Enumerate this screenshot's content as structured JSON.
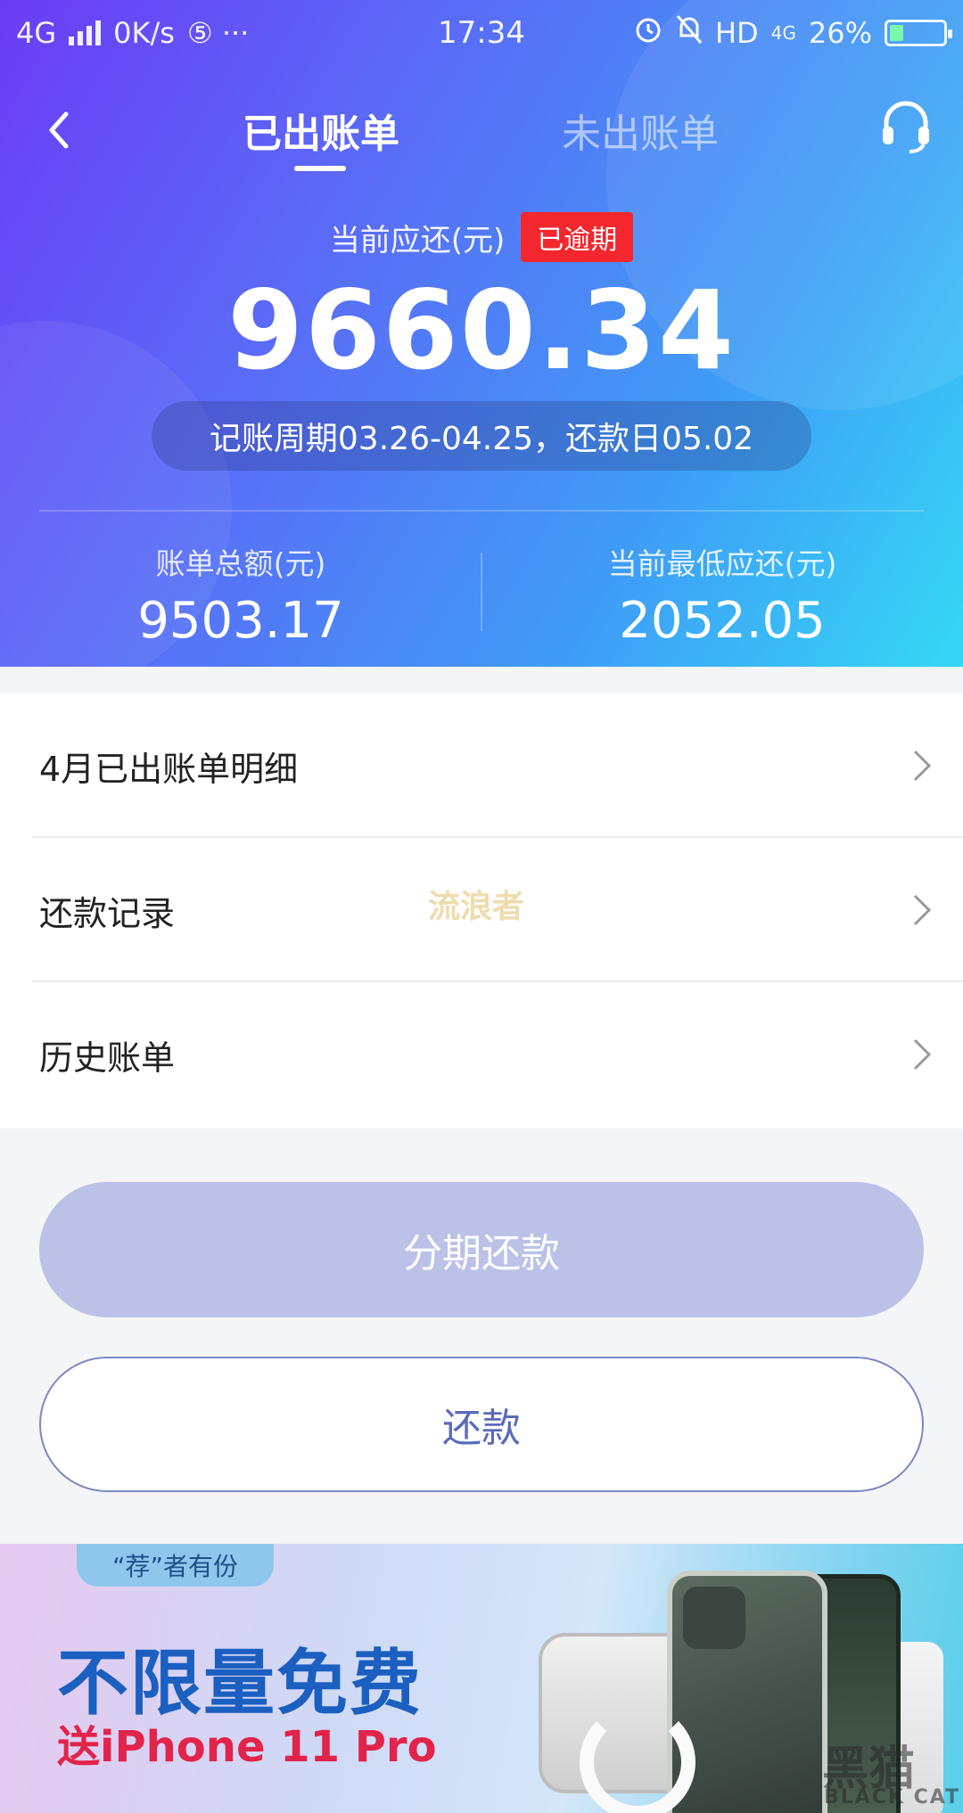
{
  "status_bar": {
    "network": "4G",
    "speed": "0K/s",
    "extra": "⑤ ···",
    "time": "17:34",
    "hd": "HD",
    "net2": "4G",
    "battery": "26%",
    "battery_level": 0.26
  },
  "nav": {
    "tabs": [
      {
        "label": "已出账单",
        "active": true
      },
      {
        "label": "未出账单",
        "active": false
      }
    ]
  },
  "summary": {
    "due_label": "当前应还(元)",
    "overdue_badge": "已逾期",
    "due_amount": "9660.34",
    "cycle": "记账周期03.26-04.25，还款日05.02",
    "total_label": "账单总额(元)",
    "total_value": "9503.17",
    "min_label": "当前最低应还(元)",
    "min_value": "2052.05"
  },
  "list": {
    "items": [
      {
        "label": "4月已出账单明细"
      },
      {
        "label": "还款记录"
      },
      {
        "label": "历史账单"
      }
    ],
    "watermark": "流浪者"
  },
  "actions": {
    "installment_label": "分期还款",
    "repay_label": "还款"
  },
  "banner": {
    "tag": "“荐”者有份",
    "title": "不限量免费",
    "subtitle": "送iPhone 11 Pro",
    "logo": "黑猫",
    "logo_sub": "BLACK CAT"
  },
  "colors": {
    "overdue": "#f4262e",
    "primary": "#5a6bbb",
    "installment_bg": "#bcc1e7"
  }
}
